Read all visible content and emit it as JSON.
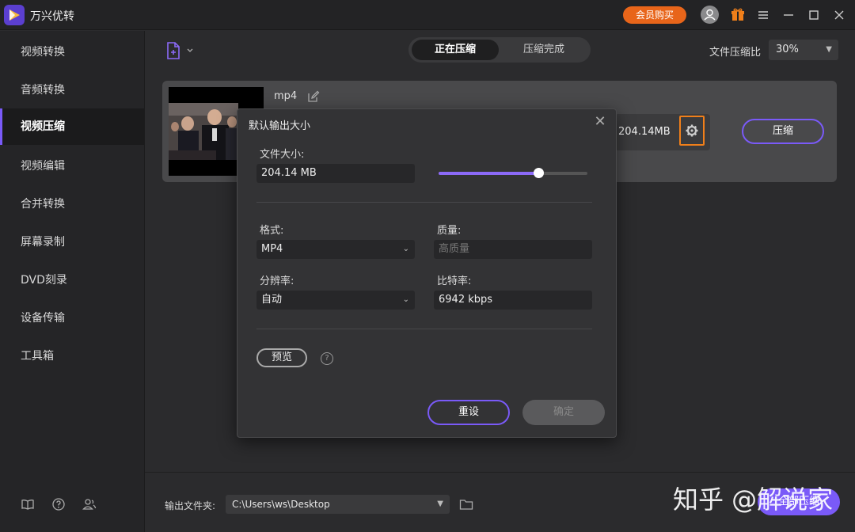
{
  "app": {
    "title": "万兴优转",
    "vip_label": "会员购买"
  },
  "sidebar": {
    "items": [
      {
        "label": "视频转换",
        "active": false
      },
      {
        "label": "音频转换",
        "active": false
      },
      {
        "label": "视频压缩",
        "active": true
      },
      {
        "label": "视频编辑",
        "active": false
      },
      {
        "label": "合并转换",
        "active": false
      },
      {
        "label": "屏幕录制",
        "active": false
      },
      {
        "label": "DVD刻录",
        "active": false
      },
      {
        "label": "设备传输",
        "active": false
      },
      {
        "label": "工具箱",
        "active": false
      }
    ]
  },
  "topbar": {
    "tabs": [
      {
        "label": "正在压缩"
      },
      {
        "label": "压缩完成"
      }
    ],
    "ratio_label": "文件压缩比",
    "ratio_value": "30%"
  },
  "file": {
    "format": "mp4",
    "size": "204.14MB",
    "compress_label": "压缩"
  },
  "modal": {
    "title": "默认输出大小",
    "size_label": "文件大小:",
    "size_value": "204.14 MB",
    "slider_fraction": 0.67,
    "format_label": "格式:",
    "format_value": "MP4",
    "quality_label": "质量:",
    "quality_value": "高质量",
    "resolution_label": "分辨率:",
    "resolution_value": "自动",
    "bitrate_label": "比特率:",
    "bitrate_value": "6942 kbps",
    "preview_label": "预览",
    "reset_label": "重设",
    "ok_label": "确定"
  },
  "bottom": {
    "output_label": "输出文件夹:",
    "output_path": "C:\\Users\\ws\\Desktop",
    "all_label": "全部压缩"
  },
  "watermark": "知乎 @解说家",
  "colors": {
    "accent": "#7a5af8",
    "orange": "#e8651a",
    "gear_highlight": "#f07f1a"
  }
}
